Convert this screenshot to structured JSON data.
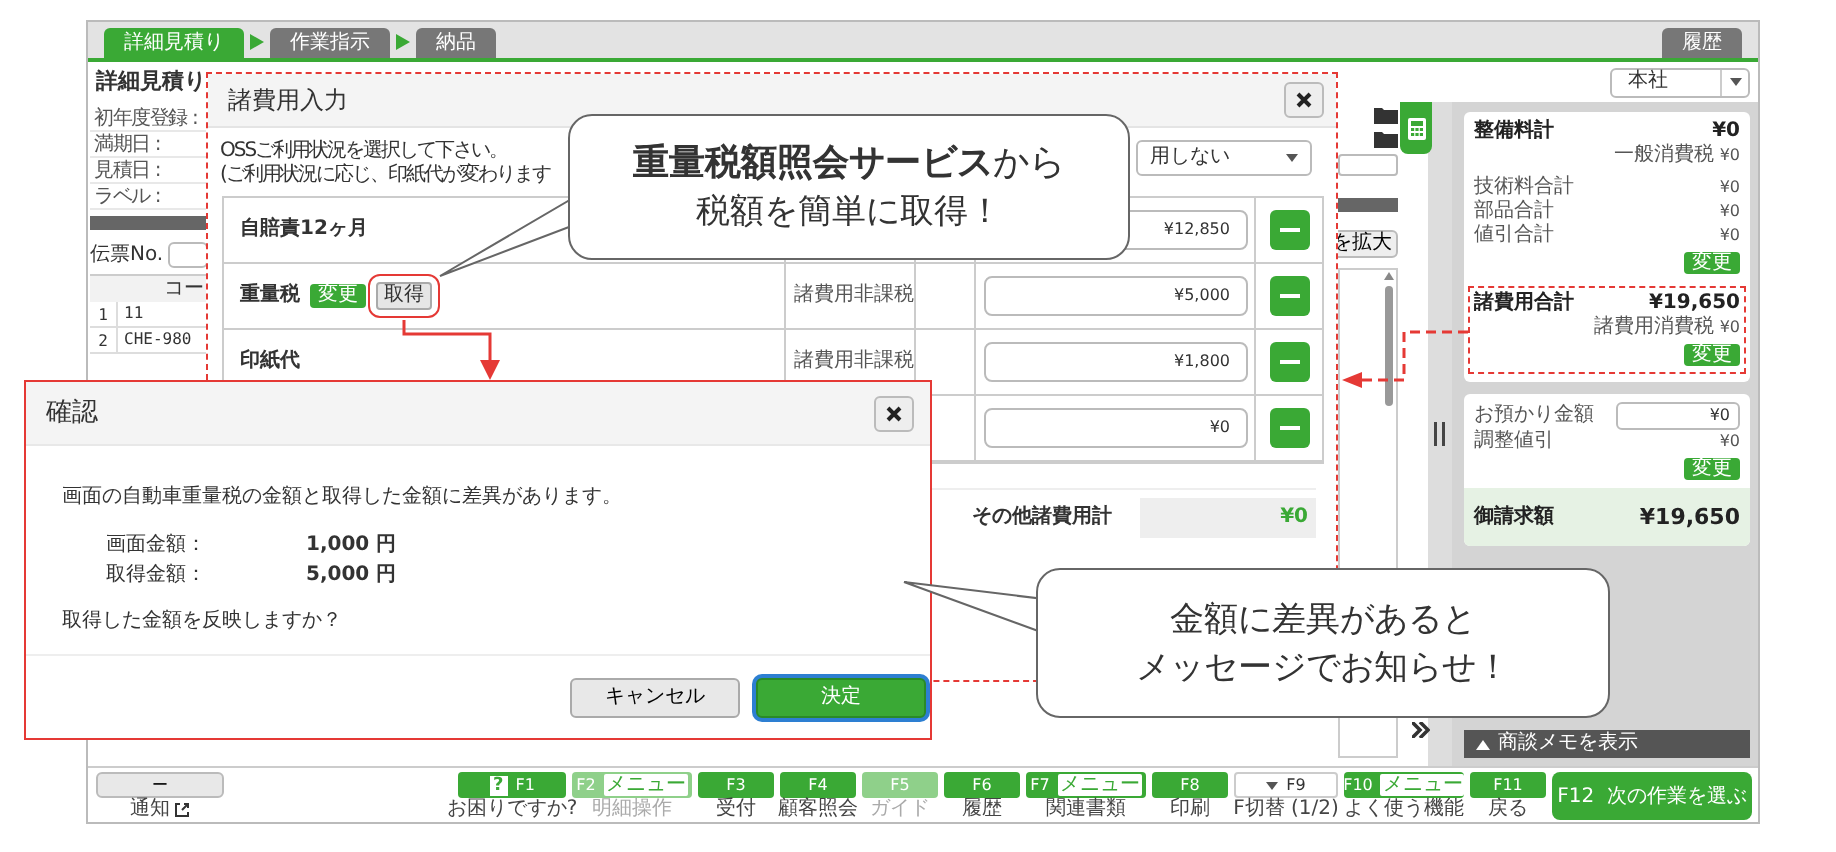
{
  "tabs": [
    {
      "label": "詳細見積り",
      "selected": true
    },
    {
      "label": "作業指示",
      "selected": false
    },
    {
      "label": "納品",
      "selected": false
    }
  ],
  "history_tab": "履歴",
  "page_title": "詳細見積り",
  "branch_select": {
    "value": "本社"
  },
  "info_labels": [
    "初年度登録 :",
    "満期日 :",
    "見積日 :",
    "ラベル :"
  ],
  "slip_no_label": "伝票No.",
  "list": {
    "column_header": "コー",
    "rows": [
      {
        "number": "1",
        "code": "11"
      },
      {
        "number": "2",
        "code": "CHE-980"
      }
    ]
  },
  "expand_button": "を拡大",
  "sidebar": {
    "maintenance": {
      "label": "整備料計",
      "value": "¥0",
      "tax_label": "一般消費税",
      "tax_value": "¥0",
      "lines": [
        {
          "label": "技術料合計",
          "value": "¥0"
        },
        {
          "label": "部品合計",
          "value": "¥0"
        },
        {
          "label": "値引合計",
          "value": "¥0"
        }
      ],
      "button": "変更"
    },
    "fees": {
      "label": "諸費用合計",
      "value": "¥19,650",
      "tax_label": "諸費用消費税",
      "tax_value": "¥0",
      "button": "変更"
    },
    "deposit": {
      "label": "お預かり金額",
      "value": "¥0"
    },
    "adjustment": {
      "label": "調整値引",
      "value": "¥0",
      "button": "変更"
    },
    "billing": {
      "label": "御請求額",
      "value": "¥19,650"
    },
    "memo_toggle": "商談メモを表示"
  },
  "fee_dialog": {
    "title": "諸費用入力",
    "instructions": [
      "OSSご利用状況を選択して下さい。",
      "(ご利用状況に応じ、印紙代が変わります"
    ],
    "oss_select": {
      "value": "用しない"
    },
    "rows": [
      {
        "label": "自賠責12ヶ月",
        "amount": "¥12,850"
      },
      {
        "label": "重量税",
        "buttons": [
          {
            "label": "変更",
            "kind": "primary"
          },
          {
            "label": "取得",
            "kind": "secondary"
          }
        ],
        "tax": "諸費用非課税",
        "amount": "¥5,000"
      },
      {
        "label": "印紙代",
        "tax": "諸費用非課税",
        "amount": "¥1,800"
      },
      {
        "amount": "¥0"
      }
    ],
    "other_total": {
      "label": "その他諸費用計",
      "value": "¥0"
    }
  },
  "confirm_dialog": {
    "title": "確認",
    "message": "画面の自動車重量税の金額と取得した金額に差異があります。",
    "amounts": [
      {
        "label": "画面金額：",
        "value": "1,000 円"
      },
      {
        "label": "取得金額：",
        "value": "5,000 円"
      }
    ],
    "question": "取得した金額を反映しますか？",
    "buttons": [
      {
        "label": "キャンセル",
        "kind": "secondary",
        "focused": false
      },
      {
        "label": "決定",
        "kind": "primary",
        "focused": true
      }
    ]
  },
  "callouts": [
    {
      "lines": [
        "**重量税額照会サービス**から",
        "税額を簡単に取得！"
      ]
    },
    {
      "lines": [
        "金額に差異があると",
        "メッセージでお知らせ！"
      ]
    }
  ],
  "function_bar": {
    "notify_button": "ー",
    "notify_label": "通知",
    "keys": [
      {
        "key": "F1",
        "kind": "help",
        "icon": "?",
        "label": "お困りですか?",
        "disabled": false
      },
      {
        "key": "F2",
        "kind": "menu",
        "badge": "メニュー",
        "label": "明細操作",
        "disabled": true
      },
      {
        "key": "F3",
        "kind": "plain",
        "label": "受付",
        "disabled": false
      },
      {
        "key": "F4",
        "kind": "plain",
        "label": "顧客照会",
        "disabled": false
      },
      {
        "key": "F5",
        "kind": "plain",
        "label": "ガイド",
        "disabled": true
      },
      {
        "key": "F6",
        "kind": "plain",
        "label": "履歴",
        "disabled": false
      },
      {
        "key": "F7",
        "kind": "menu",
        "badge": "メニュー",
        "label": "関連書類",
        "disabled": false
      },
      {
        "key": "F8",
        "kind": "plain",
        "label": "印刷",
        "disabled": false
      },
      {
        "key": "F9",
        "kind": "toggle",
        "label": "F切替 (1/2)",
        "disabled": false
      },
      {
        "key": "F10",
        "kind": "menu",
        "badge": "メニュー",
        "label": "よく使う機能",
        "disabled": false
      },
      {
        "key": "F11",
        "kind": "plain",
        "label": "戻る",
        "disabled": false
      },
      {
        "key": "F12",
        "kind": "primary",
        "label": "次の作業を選ぶ",
        "disabled": false
      }
    ]
  }
}
